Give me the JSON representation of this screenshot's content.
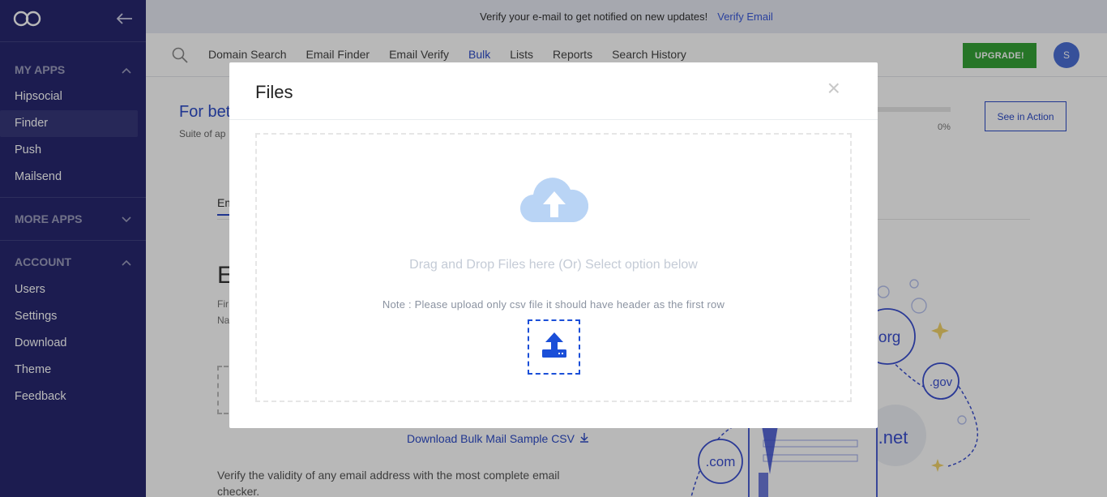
{
  "sidebar": {
    "collapse_icon": "arrow-left-icon",
    "sections": {
      "my_apps": {
        "title": "MY APPS",
        "items": [
          "Hipsocial",
          "Finder",
          "Push",
          "Mailsend"
        ]
      },
      "more_apps": {
        "title": "MORE APPS"
      },
      "account": {
        "title": "ACCOUNT",
        "items": [
          "Users",
          "Settings",
          "Download",
          "Theme",
          "Feedback"
        ]
      }
    }
  },
  "notify": {
    "text": "Verify your e-mail to get notified on new updates!",
    "link": "Verify Email"
  },
  "nav": {
    "items": [
      "Domain Search",
      "Email Finder",
      "Email Verify",
      "Bulk",
      "Lists",
      "Reports",
      "Search History"
    ],
    "active": "Bulk",
    "upgrade_label": "UPGRADE!",
    "avatar_initial": "S"
  },
  "main": {
    "hero_title_fragment": "For bet",
    "hero_sub_fragment": "Suite of ap",
    "progress_percent": "0%",
    "progress_value": 0,
    "see_in_action": "See in Action",
    "tab_fragment": "Em",
    "heading_fragment": "E",
    "line1_fragment": "Fir",
    "line2_fragment": "Na",
    "download_link": "Download Bulk Mail Sample CSV",
    "description": "Verify the validity of any email address with the most complete email checker.",
    "illustration_labels": [
      ".org",
      ".gov",
      ".com",
      ".net"
    ]
  },
  "modal": {
    "title": "Files",
    "close_glyph": "×",
    "drop_text": "Drag and Drop Files here (Or) Select option below",
    "note": "Note : Please upload only csv file it should have header as the first row"
  },
  "colors": {
    "sidebar_bg": "#272870",
    "accent": "#2d4cc8",
    "upgrade": "#35a336",
    "upload_blue": "#1b4fd8",
    "cloud": "#b9d4f5"
  }
}
